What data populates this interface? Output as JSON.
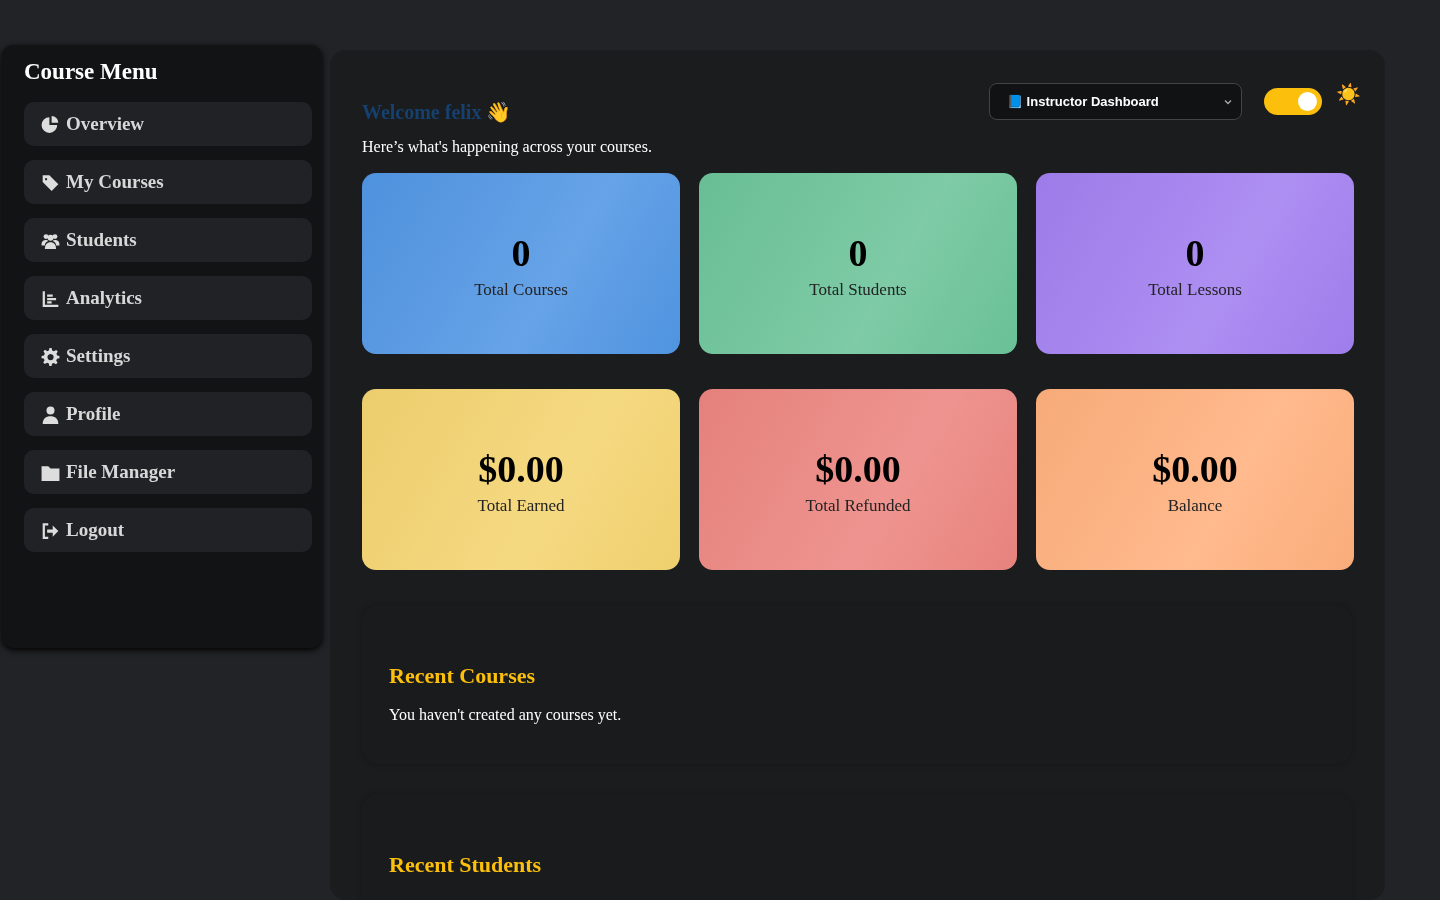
{
  "sidebar": {
    "title": "Course Menu",
    "items": [
      {
        "label": "Overview"
      },
      {
        "label": "My Courses"
      },
      {
        "label": "Students"
      },
      {
        "label": "Analytics"
      },
      {
        "label": "Settings"
      },
      {
        "label": "Profile"
      },
      {
        "label": "File Manager"
      },
      {
        "label": "Logout"
      }
    ]
  },
  "header": {
    "welcome": "Welcome felix 👋",
    "subtitle": "Here’s what's happening across your courses.",
    "dashboard_select": {
      "value": "📘 Instructor Dashboard"
    },
    "theme_toggle": {
      "on": true
    },
    "sun_icon": "☀️"
  },
  "stats": [
    {
      "value": "0",
      "label": "Total Courses",
      "color": "#5196e4"
    },
    {
      "value": "0",
      "label": "Total Students",
      "color": "#6cc49a"
    },
    {
      "value": "0",
      "label": "Total Lessons",
      "color": "#a27ff0"
    },
    {
      "value": "$0.00",
      "label": "Total Earned",
      "color": "#f4d470"
    },
    {
      "value": "$0.00",
      "label": "Total Refunded",
      "color": "#ec8580"
    },
    {
      "value": "$0.00",
      "label": "Balance",
      "color": "#ffb07d"
    }
  ],
  "sections": [
    {
      "title": "Recent Courses",
      "text": "You haven't created any courses yet."
    },
    {
      "title": "Recent Students"
    }
  ]
}
